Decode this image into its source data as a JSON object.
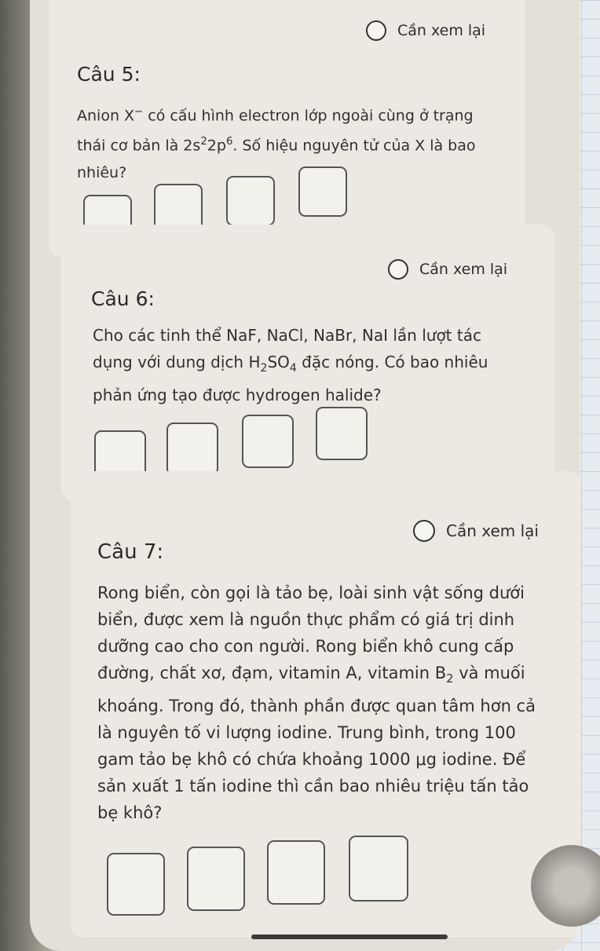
{
  "questions": [
    {
      "title": "Câu 5:",
      "review_label": "Cần xem lại",
      "text_parts": {
        "line1_a": "Anion X",
        "line1_sup": "−",
        "line1_b": " có cấu hình electron lớp ngoài cùng ở trạng",
        "line2_a": "thái cơ bản là 2s",
        "line2_sup1": "2",
        "line2_b": "2p",
        "line2_sup2": "6",
        "line2_c": ". Số hiệu nguyên tử của X là bao",
        "line3": "nhiêu?"
      },
      "answer_boxes": 4
    },
    {
      "title": "Câu 6:",
      "review_label": "Cần xem lại",
      "text_parts": {
        "line1": "Cho các tinh thể NaF, NaCl, NaBr, NaI lần lượt tác",
        "line2_a": "dụng với dung dịch H",
        "line2_sub1": "2",
        "line2_b": "SO",
        "line2_sub2": "4",
        "line2_c": " đặc nóng. Có bao nhiêu",
        "line3": "phản ứng tạo được hydrogen halide?"
      },
      "answer_boxes": 4
    },
    {
      "title": "Câu 7:",
      "review_label": "Cần xem lại",
      "text_parts": {
        "line1": "Rong biển, còn gọi là tảo bẹ, loài sinh vật sống dưới",
        "line2": "biển, được xem là nguồn thực phẩm có giá trị dinh",
        "line3": "dưỡng cao cho con người. Rong biển khô cung cấp",
        "line4_a": "đường, chất xơ, đạm, vitamin A, vitamin B",
        "line4_sub": "2",
        "line4_b": " và muối",
        "line5": "khoáng. Trong đó, thành phần được quan tâm hơn cả",
        "line6": "là nguyên tố vi lượng iodine. Trung bình, trong 100",
        "line7": "gam tảo bẹ khô có chứa khoảng 1000 μg iodine. Để",
        "line8": "sản xuất 1 tấn iodine thì cần bao nhiêu triệu tấn tảo",
        "line9": "bẹ khô?"
      },
      "answer_boxes": 4
    }
  ]
}
